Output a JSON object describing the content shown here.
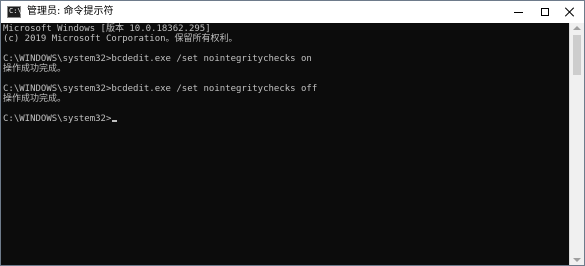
{
  "window": {
    "title": "管理员: 命令提示符",
    "icon": "cmd-icon",
    "icon_text": "C:\\"
  },
  "controls": {
    "minimize_icon": "minimize-icon",
    "maximize_icon": "maximize-icon",
    "close_icon": "close-icon"
  },
  "console": {
    "lines": [
      "Microsoft Windows [版本 10.0.18362.295]",
      "(c) 2019 Microsoft Corporation。保留所有权利。",
      "",
      "C:\\WINDOWS\\system32>bcdedit.exe /set nointegritychecks on",
      "操作成功完成。",
      "",
      "C:\\WINDOWS\\system32>bcdedit.exe /set nointegritychecks off",
      "操作成功完成。",
      "",
      "C:\\WINDOWS\\system32>"
    ],
    "text_color": "#c0c0c0",
    "background_color": "#0c0c0c"
  }
}
